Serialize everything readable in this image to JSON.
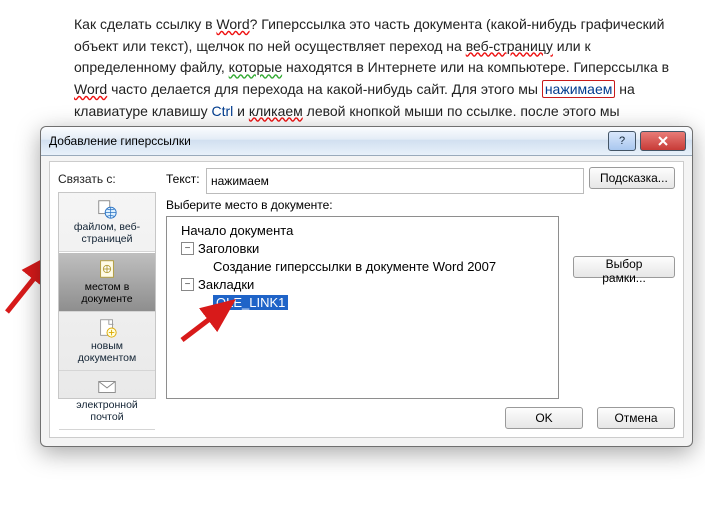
{
  "doc": {
    "para_parts": [
      {
        "t": "Как сделать ссылку в "
      },
      {
        "t": "Word",
        "cls": "wavy-red"
      },
      {
        "t": "? Гиперссылка это часть документа (какой-нибудь графический объект или текст), щелчок по ней осуществляет переход на "
      },
      {
        "t": "веб-страницу",
        "cls": "wavy-red"
      },
      {
        "t": " или к определенному файлу, "
      },
      {
        "t": "которые",
        "cls": "wavy-green"
      },
      {
        "t": " находятся в Интернете или на компьютере. Гиперссылка в "
      },
      {
        "t": "Word",
        "cls": "wavy-red"
      },
      {
        "t": " часто делается  для перехода на какой-нибудь сайт. Для этого мы "
      },
      {
        "t": "нажимаем",
        "cls": "link-box"
      },
      {
        "t": " на клавиатуре клавишу "
      },
      {
        "t": "Ctrl",
        "cls": "kw"
      },
      {
        "t": " и "
      },
      {
        "t": "кликаем",
        "cls": "wavy-red"
      },
      {
        "t": " левой кнопкой мыши по ссылке. после этого мы автоматически попадаем на нужный нам сайт или"
      }
    ]
  },
  "dialog": {
    "title": "Добавление гиперссылки",
    "link_with_label": "Связать с:",
    "text_label": "Текст:",
    "text_value": "нажимаем",
    "hint_btn": "Подсказка...",
    "pick_label": "Выберите место в документе:",
    "frame_btn": "Выбор рамки...",
    "ok": "OK",
    "cancel": "Отмена",
    "categories": [
      {
        "label": "файлом, веб-страницей",
        "selected": false
      },
      {
        "label": "местом в документе",
        "selected": true
      },
      {
        "label": "новым документом",
        "selected": false
      },
      {
        "label": "электронной почтой",
        "selected": false
      }
    ],
    "tree": {
      "root": "Начало документа",
      "headings": "Заголовки",
      "heading_item": "Создание гиперссылки в документе Word 2007",
      "bookmarks": "Закладки",
      "bookmark_item": "OLE_LINK1"
    }
  }
}
